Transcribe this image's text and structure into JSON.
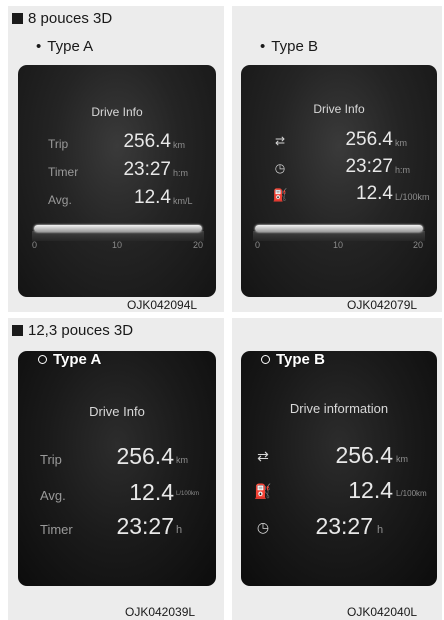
{
  "section1": {
    "title": "8 pouces 3D",
    "typeA": {
      "label": "Type A",
      "title": "Drive Info",
      "rows": [
        {
          "label": "Trip",
          "value": "256.4",
          "unit": "km"
        },
        {
          "label": "Timer",
          "value": "23:27",
          "unit": "h:m"
        },
        {
          "label": "Avg.",
          "value": "12.4",
          "unit": "km/L"
        }
      ],
      "scale": [
        "0",
        "10",
        "20"
      ],
      "code": "OJK042094L"
    },
    "typeB": {
      "label": "Type B",
      "title": "Drive Info",
      "rows": [
        {
          "icon": "car-icon",
          "value": "256.4",
          "unit": "km"
        },
        {
          "icon": "clock-icon",
          "value": "23:27",
          "unit": "h:m"
        },
        {
          "icon": "fuel-pump-icon",
          "value": "12.4",
          "unit": "L/100km"
        }
      ],
      "scale": [
        "0",
        "10",
        "20"
      ],
      "code": "OJK042079L"
    }
  },
  "section2": {
    "title": "12,3 pouces 3D",
    "typeA": {
      "label": "Type A",
      "title": "Drive Info",
      "rows": [
        {
          "label": "Trip",
          "value": "256.4",
          "unit": "km"
        },
        {
          "label": "Avg.",
          "value": "12.4",
          "unit": "L/100km"
        },
        {
          "label": "Timer",
          "value": "23:27",
          "unit": "h"
        }
      ],
      "code": "OJK042039L"
    },
    "typeB": {
      "label": "Type B",
      "title": "Drive information",
      "rows": [
        {
          "icon": "car-icon",
          "value": "256.4",
          "unit": "km"
        },
        {
          "icon": "fuel-pump-icon",
          "value": "12.4",
          "unit": "L/100km"
        },
        {
          "icon": "clock-icon",
          "value": "23:27",
          "unit": "h"
        }
      ],
      "code": "OJK042040L"
    }
  }
}
